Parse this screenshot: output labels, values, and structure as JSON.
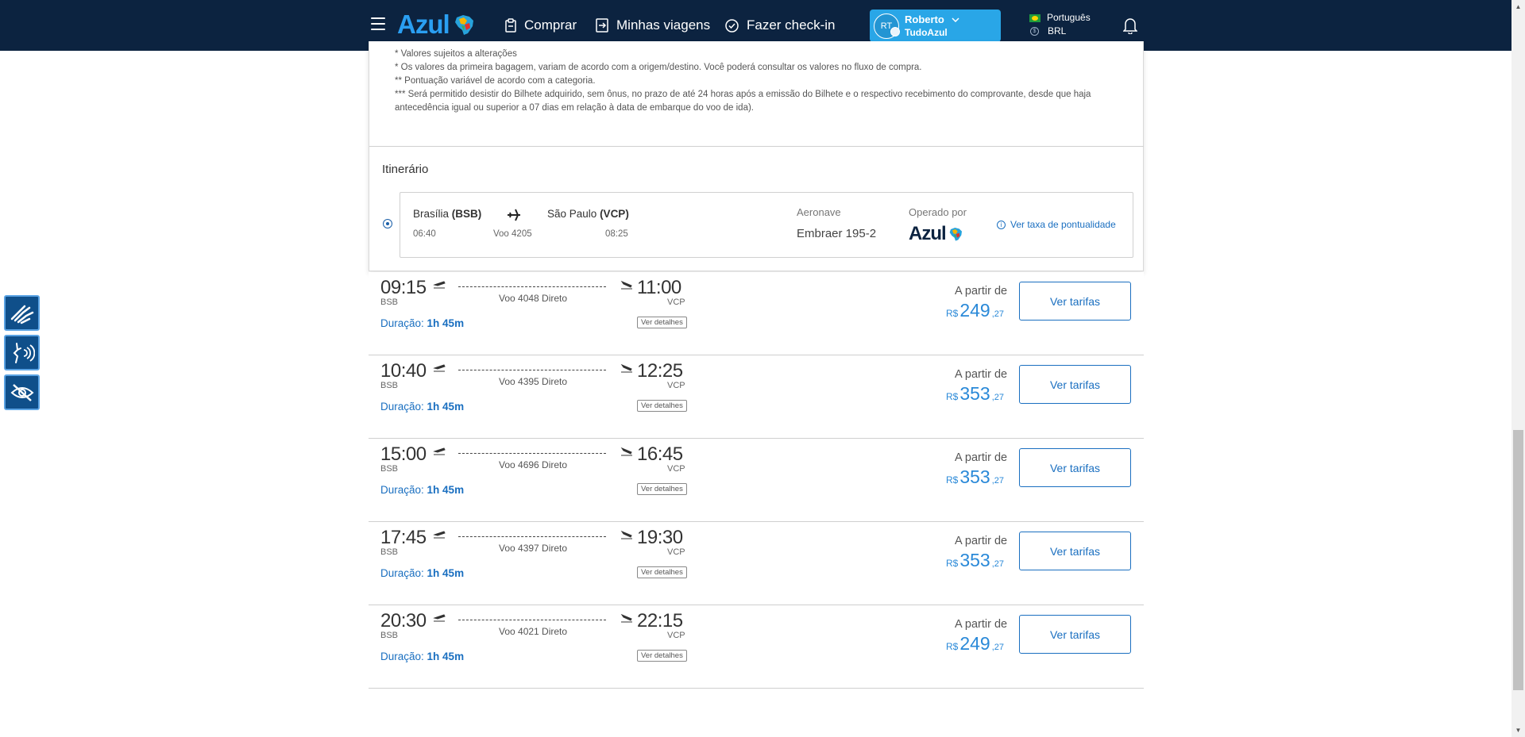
{
  "header": {
    "logo_text": "Azul",
    "nav": [
      {
        "label": "Comprar",
        "icon": "clipboard-icon"
      },
      {
        "label": "Minhas viagens",
        "icon": "boarding-pass-icon"
      },
      {
        "label": "Fazer check-in",
        "icon": "check-circle-icon"
      }
    ],
    "user": {
      "initials": "RT",
      "name": "Roberto",
      "program": "TudoAzul"
    },
    "language": "Português",
    "currency": "BRL"
  },
  "accent_color": "#2a89d8",
  "header_color": "#0c2340",
  "notes": [
    "* Valores sujeitos a alterações",
    "* Os valores da primeira bagagem, variam de acordo com a origem/destino. Você poderá consultar os valores no fluxo de compra.",
    "** Pontuação variável de acordo com a categoria.",
    "*** Será permitido desistir do Bilhete adquirido, sem ônus, no prazo de até 24 horas após a emissão do Bilhete e o respectivo recebimento do comprovante, desde que haja antecedência igual ou superior a 07 dias em relação à data de embarque do voo de ida)."
  ],
  "itinerary": {
    "title": "Itinerário",
    "origin_city": "Brasília ",
    "origin_code": "(BSB)",
    "dest_city": "São Paulo ",
    "dest_code": "(VCP)",
    "depart_time": "06:40",
    "arrive_time": "08:25",
    "flight": "Voo 4205",
    "aircraft_label": "Aeronave",
    "aircraft": "Embraer 195-2",
    "operated_label": "Operado por",
    "operator_logo": "Azul",
    "punctuality_link": "Ver taxa de pontualidade"
  },
  "flights": [
    {
      "depart": "09:15",
      "origin": "BSB",
      "arrive": "11:00",
      "dest": "VCP",
      "flight": "Voo 4048 Direto",
      "duration_label": "Duração:",
      "duration": "1h 45m",
      "details": "Ver detalhes",
      "from": "A partir de",
      "currency": "R$",
      "price_int": "249",
      "price_cents": ",27",
      "button": "Ver tarifas"
    },
    {
      "depart": "10:40",
      "origin": "BSB",
      "arrive": "12:25",
      "dest": "VCP",
      "flight": "Voo 4395 Direto",
      "duration_label": "Duração:",
      "duration": "1h 45m",
      "details": "Ver detalhes",
      "from": "A partir de",
      "currency": "R$",
      "price_int": "353",
      "price_cents": ",27",
      "button": "Ver tarifas"
    },
    {
      "depart": "15:00",
      "origin": "BSB",
      "arrive": "16:45",
      "dest": "VCP",
      "flight": "Voo 4696 Direto",
      "duration_label": "Duração:",
      "duration": "1h 45m",
      "details": "Ver detalhes",
      "from": "A partir de",
      "currency": "R$",
      "price_int": "353",
      "price_cents": ",27",
      "button": "Ver tarifas"
    },
    {
      "depart": "17:45",
      "origin": "BSB",
      "arrive": "19:30",
      "dest": "VCP",
      "flight": "Voo 4397 Direto",
      "duration_label": "Duração:",
      "duration": "1h 45m",
      "details": "Ver detalhes",
      "from": "A partir de",
      "currency": "R$",
      "price_int": "353",
      "price_cents": ",27",
      "button": "Ver tarifas"
    },
    {
      "depart": "20:30",
      "origin": "BSB",
      "arrive": "22:15",
      "dest": "VCP",
      "flight": "Voo 4021 Direto",
      "duration_label": "Duração:",
      "duration": "1h 45m",
      "details": "Ver detalhes",
      "from": "A partir de",
      "currency": "R$",
      "price_int": "249",
      "price_cents": ",27",
      "button": "Ver tarifas"
    }
  ]
}
